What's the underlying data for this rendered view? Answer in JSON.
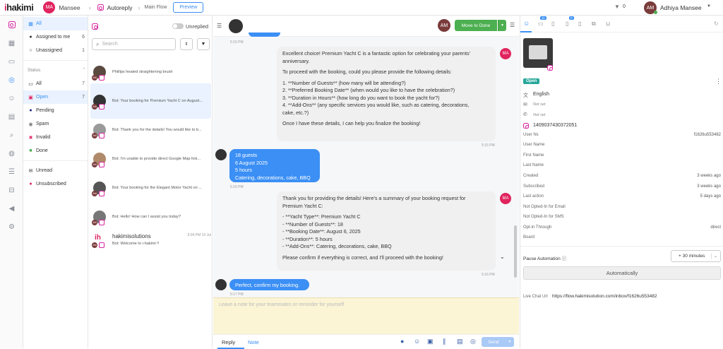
{
  "topbar": {
    "logo_prefix": "i",
    "logo_main": "hakimi",
    "user_initials": "MA",
    "user_name": "Mansee",
    "flow_name": "Autoreply",
    "flow_type": "Main Flow",
    "preview_label": "Preview",
    "notif_count": "0",
    "agent_initials": "AM",
    "agent_name": "Adhiya Mansee"
  },
  "left_nav": {
    "icons": [
      "instagram-icon",
      "grid-icon",
      "chat-icon",
      "headset-icon",
      "user-icon",
      "inbox-icon",
      "search-icon",
      "globe-icon",
      "list-icon",
      "archive-icon",
      "megaphone-icon",
      "settings-icon"
    ]
  },
  "filters": {
    "all_label": "All",
    "assigned_label": "Assigned to me",
    "assigned_count": "6",
    "unassigned_label": "Unassigned",
    "unassigned_count": "1",
    "status_label": "Status",
    "status_all_label": "All",
    "status_all_count": "7",
    "open_label": "Open",
    "open_count": "7",
    "pending_label": "Pending",
    "spam_label": "Spam",
    "invalid_label": "Invalid",
    "done_label": "Done",
    "unread_label": "Unread",
    "unsubscribed_label": "Unsubscribed"
  },
  "conv_list": {
    "unreplied_label": "Unreplied",
    "search_placeholder": "Search",
    "items": [
      {
        "text": "Phillips heated straightening brush"
      },
      {
        "text": "Bot: Your booking for Premium Yacht C on August..."
      },
      {
        "text": "Bot: Thank you for the details! You would like to b..."
      },
      {
        "text": "Bot: I'm unable to provide direct Google Map link..."
      },
      {
        "text": "Bot: Your booking for the Elegant Motor Yacht on ..."
      },
      {
        "text": "Bot: Hello! How can I assist you today?"
      },
      {
        "name": "hakimisolutions",
        "time": "5:04 PM 14 Jul",
        "text": "Bot: Welcome to i-hakimi !!"
      }
    ]
  },
  "chat": {
    "agent_initials": "AM",
    "move_done_label": "Move to Done",
    "bot_initials": "MA",
    "ts1": "5:15 PM",
    "msg1_lines": [
      "Excellent choice! Premium Yacht C is a fantastic option for celebrating your parents'",
      "anniversary.",
      "",
      "To proceed with the booking, could you please provide the following details:",
      "",
      "1. **Number of Guests** (how many will be attending?)",
      "2. **Preferred Booking Date** (when would you like to have the celebration?)",
      "3. **Duration in Hours** (how long do you want to book the yacht for?)",
      "4. **Add-Ons** (any specific services you would like, such as catering, decorations,",
      "cake, etc.?)",
      "",
      "Once I have these details, I can help you finalize the booking!"
    ],
    "ts2": "5:15 PM",
    "msg2_lines": [
      "18 guests",
      "6 August 2025",
      "5 hours",
      "Catering, decorations, cake, BBQ"
    ],
    "ts3": "5:16 PM",
    "msg3_lines": [
      "Thank you for providing the details! Here's a summary of your booking request for",
      "Premium Yacht C:",
      "",
      "- **Yacht Type**: Premium Yacht C",
      "- **Number of Guests**: 18",
      "- **Booking Date**: August 6, 2025",
      "- **Duration**: 5 hours",
      "- **Add-Ons**: Catering, decorations, cake, BBQ",
      "",
      "Please confirm if everything is correct, and I'll proceed with the booking!"
    ],
    "ts4": "5:16 PM",
    "msg4": "Perfect, confirm my booking.",
    "ts5": "5:17 PM",
    "note_placeholder": "Leave a note for your teammates or reminder for yourself",
    "reply_tab": "Reply",
    "note_tab": "Note",
    "send_label": "Send"
  },
  "profile": {
    "tab_badge1": "11",
    "tab_badge2": "0",
    "status_badge": "Open",
    "language": "English",
    "email": "Not set",
    "phone": "Not set",
    "ig_id": "1409037430372051",
    "rows": [
      {
        "label": "User Ns",
        "value": "f1626u553482"
      },
      {
        "label": "User Name",
        "value": ""
      },
      {
        "label": "First Name",
        "value": ""
      },
      {
        "label": "Last Name",
        "value": ""
      },
      {
        "label": "Created",
        "value": "3 weeks ago"
      },
      {
        "label": "Subscribed",
        "value": "3 weeks ago"
      },
      {
        "label": "Last action",
        "value": "5 days ago"
      },
      {
        "label": "Not Opted-In for Email",
        "value": ""
      },
      {
        "label": "Not Opted-In for SMS",
        "value": ""
      },
      {
        "label": "Opt-in Through",
        "value": "direct"
      },
      {
        "label": "Board",
        "value": ""
      }
    ],
    "pause_label": "Pause Automation ⓘ",
    "pause_value": "+ 30 minutes",
    "auto_label": "Automatically",
    "livechat_label": "Live Chat Url",
    "livechat_url": "https://flow.hakimisolution.com/inbox/f1626u553482"
  },
  "colors": {
    "accent": "#3b8ff5",
    "brand_pink": "#e0245e",
    "done_green": "#4caf50",
    "open_badge": "#26a69a",
    "note_bg": "#fbf4d5"
  }
}
